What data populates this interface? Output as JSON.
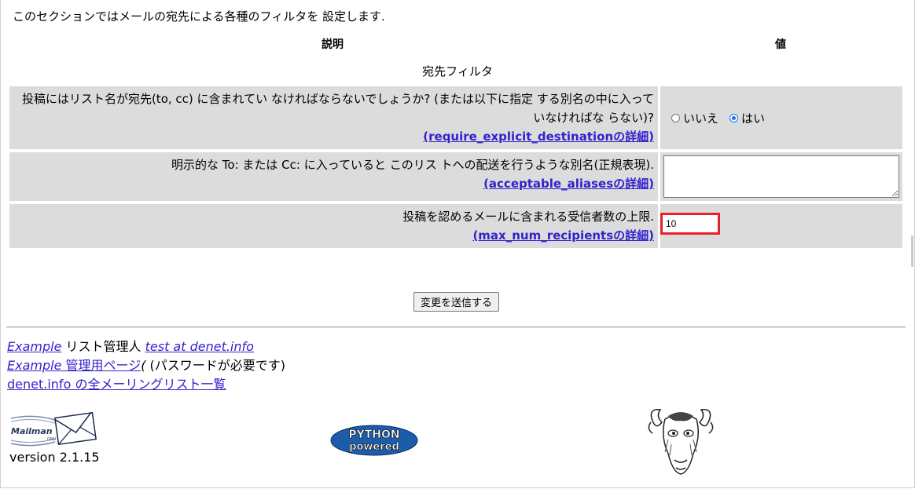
{
  "intro": "このセクションではメールの宛先による各種のフィルタを 設定します.",
  "headers": {
    "description": "説明",
    "value": "値"
  },
  "section_title": "宛先フィルタ",
  "rows": [
    {
      "text": "投稿にはリスト名が宛先(to, cc) に含まれてい なければならないでしょうか? (または以下に指定 する別名の中に入っていなければな らない)?",
      "link": "(require_explicit_destinationの詳細)",
      "options": [
        "いいえ",
        "はい"
      ],
      "selected": "はい"
    },
    {
      "text": "明示的な To: または Cc: に入っていると このリス トへの配送を行うような別名(正規表現).",
      "link": "(acceptable_aliasesの詳細)",
      "value": ""
    },
    {
      "text": "投稿を認めるメールに含まれる受信者数の上限.",
      "link": "(max_num_recipientsの詳細)",
      "value": "10"
    }
  ],
  "submit_label": "変更を送信する",
  "footer": {
    "line1_list": "Example",
    "line1_text": " リスト管理人 ",
    "line1_admin": "test at denet.info",
    "line2_list": "Example",
    "line2_link": " 管理用ページ",
    "line2_text": " (パスワードが必要です)",
    "line3_link": "denet.info の全メーリングリスト一覧",
    "version": "version 2.1.15"
  },
  "logos": {
    "mailman": "Mailman",
    "python": [
      "PYTHON",
      "powered"
    ]
  },
  "colors": {
    "row_bg": "#dcdcdc",
    "link": "#3322cc",
    "highlight": "#e8202a"
  }
}
